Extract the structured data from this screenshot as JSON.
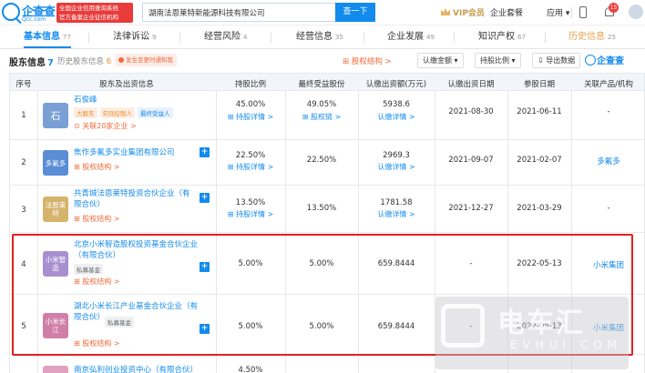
{
  "header": {
    "logo_text": "企查查",
    "logo_sub": "Qcc.com",
    "badge_line1": "全国企业信用查询系统",
    "badge_line2": "官方备案企业征信机构",
    "search_value": "湖南法恩莱特新能源科技有限公司",
    "search_button": "查一下",
    "vip": "VIP会员",
    "nav_suite": "企业套餐",
    "nav_apps": "应用",
    "notif_count": "15"
  },
  "tabs": [
    {
      "label": "基本信息",
      "count": "77"
    },
    {
      "label": "法律诉讼",
      "count": "9"
    },
    {
      "label": "经营风险",
      "count": "4"
    },
    {
      "label": "经营信息",
      "count": "35"
    },
    {
      "label": "企业发展",
      "count": "49"
    },
    {
      "label": "知识产权",
      "count": "67"
    },
    {
      "label": "历史信息",
      "count": "25"
    }
  ],
  "section": {
    "title": "股东信息",
    "count": "7",
    "history": "历史股东信息",
    "history_count": "6",
    "warn": "发生变更时通知我",
    "equity": "股权结构",
    "filter1": "认缴金额",
    "filter2": "持股比例",
    "export": "导出数据",
    "qcc": "企查查"
  },
  "columns": [
    "序号",
    "股东及出资信息",
    "持股比例",
    "最终受益股份",
    "认缴出资额(万元)",
    "认缴出资日期",
    "参股日期",
    "关联产品/机构"
  ],
  "rows": [
    {
      "idx": "1",
      "avatar": "石",
      "avatar_color": "#7a9fd4",
      "name": "石俊峰",
      "tags": [
        "大股东",
        "实际控制人",
        "最终受益人"
      ],
      "sub": "关联20家企业",
      "ratio": "45.00%",
      "ratio_link": "持股详情",
      "benefit": "49.05%",
      "benefit_link": "股权链",
      "amount": "5938.6",
      "amount_link": "认缴详情",
      "sub_date": "2021-08-30",
      "join_date": "2021-06-11",
      "product": "-"
    },
    {
      "idx": "2",
      "avatar": "多氟多",
      "avatar_color": "#5a8dd6",
      "name": "焦作多氟多实业集团有限公司",
      "tags": [],
      "sub": "股权结构",
      "ratio": "22.50%",
      "ratio_link": "持股详情",
      "benefit": "22.50%",
      "benefit_link": "",
      "amount": "2969.3",
      "amount_link": "认缴详情",
      "sub_date": "2021-09-07",
      "join_date": "2021-02-07",
      "product": "多氟多"
    },
    {
      "idx": "3",
      "avatar": "法恩莱特",
      "avatar_color": "#d4b36a",
      "name": "共青城法恩莱特投资合伙企业（有限合伙）",
      "tags": [],
      "sub": "股权结构",
      "ratio": "13.50%",
      "ratio_link": "持股详情",
      "benefit": "13.50%",
      "benefit_link": "",
      "amount": "1781.58",
      "amount_link": "认缴详情",
      "sub_date": "2021-12-27",
      "join_date": "2021-03-29",
      "product": "-"
    },
    {
      "idx": "4",
      "avatar": "小米智造",
      "avatar_color": "#a88fd0",
      "name": "北京小米智造股权投资基金合伙企业（有限合伙）",
      "tags": [
        "私募基金"
      ],
      "sub": "股权结构",
      "ratio": "5.00%",
      "ratio_link": "",
      "benefit": "5.00%",
      "benefit_link": "",
      "amount": "659.8444",
      "amount_link": "",
      "sub_date": "-",
      "join_date": "2022-05-13",
      "product": "小米集团"
    },
    {
      "idx": "5",
      "avatar": "小米长江",
      "avatar_color": "#d080a8",
      "name": "湖北小米长江产业基金合伙企业（有限合伙）",
      "tags": [
        "私募基金"
      ],
      "sub": "股权结构",
      "ratio": "5.00%",
      "ratio_link": "",
      "benefit": "5.00%",
      "benefit_link": "",
      "amount": "659.8444",
      "amount_link": "",
      "sub_date": "-",
      "join_date": "2022-05-13",
      "product": "小米集团"
    }
  ],
  "row6_partial": {
    "name": "南京弘利创业投资中心（有限合伙）",
    "ratio": "4.50%"
  },
  "watermark": {
    "text": "电车汇",
    "sub": "EVHUI.COM"
  }
}
